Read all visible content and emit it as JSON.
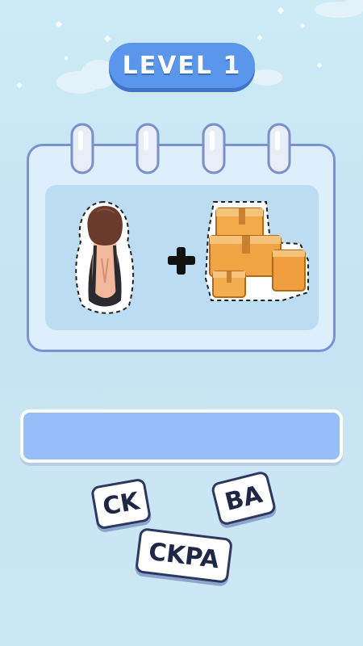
{
  "level": {
    "label": "LEVEL 1"
  },
  "puzzle": {
    "left_picture": "woman-back-icon",
    "operator_icon": "plus-icon",
    "right_picture": "cardboard-boxes-icon"
  },
  "answer": {
    "value": ""
  },
  "tiles": [
    {
      "text": "CK"
    },
    {
      "text": "BA"
    },
    {
      "text": "CKPA"
    }
  ],
  "colors": {
    "background": "#cdeaf7",
    "badge": "#5a96ec",
    "card_border": "#7b92d2",
    "answer_box": "#95bff6",
    "tile_border": "#2e3760"
  }
}
